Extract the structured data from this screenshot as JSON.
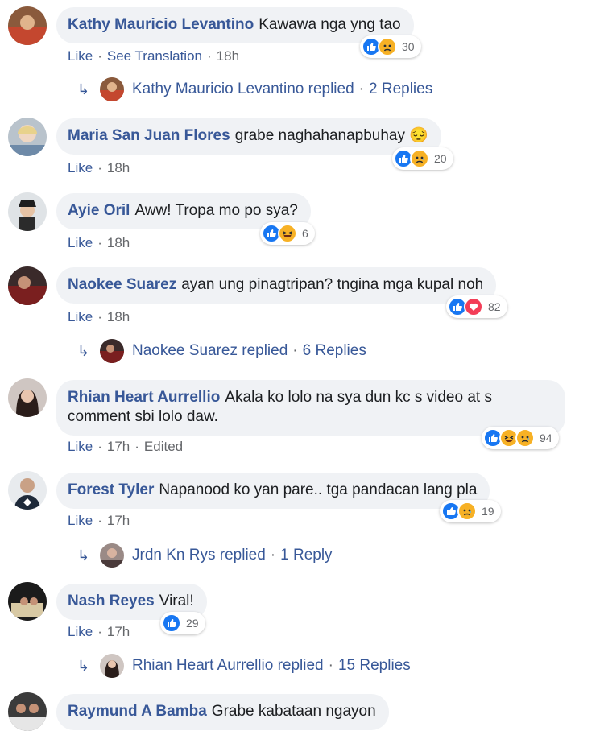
{
  "comments": [
    {
      "name": "Kathy Mauricio Levantino",
      "text": "Kawawa nga yng tao",
      "actions": [
        "Like",
        "See Translation"
      ],
      "time": "18h",
      "reactions": "30",
      "reply": {
        "name": "Kathy Mauricio Levantino replied",
        "count": "2 Replies"
      }
    },
    {
      "name": "Maria San Juan Flores",
      "text": "grabe naghahanapbuhay 😔",
      "actions": [
        "Like"
      ],
      "time": "18h",
      "reactions": "20"
    },
    {
      "name": "Ayie Oril",
      "text": "Aww! Tropa mo po sya?",
      "actions": [
        "Like"
      ],
      "time": "18h",
      "reactions": "6"
    },
    {
      "name": "Naokee Suarez",
      "text": "ayan ung pinagtripan? tngina mga kupal noh",
      "actions": [
        "Like"
      ],
      "time": "18h",
      "reactions": "82",
      "reply": {
        "name": "Naokee Suarez replied",
        "count": "6 Replies"
      }
    },
    {
      "name": "Rhian Heart Aurrellio",
      "text": "Akala ko lolo na sya dun kc s video at s comment sbi lolo daw.",
      "actions": [
        "Like"
      ],
      "time": "17h",
      "edited": "Edited",
      "reactions": "94"
    },
    {
      "name": "Forest Tyler",
      "text": "Napanood ko yan pare.. tga pandacan lang pla",
      "actions": [
        "Like"
      ],
      "time": "17h",
      "reactions": "19",
      "reply": {
        "name": "Jrdn Kn Rys replied",
        "count": "1 Reply"
      }
    },
    {
      "name": "Nash Reyes",
      "text": "Viral!",
      "actions": [
        "Like"
      ],
      "time": "17h",
      "reactions": "29",
      "reply": {
        "name": "Rhian Heart Aurrellio replied",
        "count": "15 Replies"
      }
    },
    {
      "name": "Raymund A Bamba",
      "text": "Grabe kabataan ngayon"
    }
  ],
  "colors": {
    "link": "#385898",
    "meta": "#65676b",
    "bubble": "#f0f2f5",
    "like": "#1877f2",
    "sad": "#f7b125",
    "love": "#f33e58"
  },
  "icons": {
    "reply_arrow": "reply-arrow-icon",
    "like": "like-reaction-icon",
    "sad": "sad-reaction-icon",
    "haha": "haha-reaction-icon",
    "love": "love-reaction-icon"
  }
}
